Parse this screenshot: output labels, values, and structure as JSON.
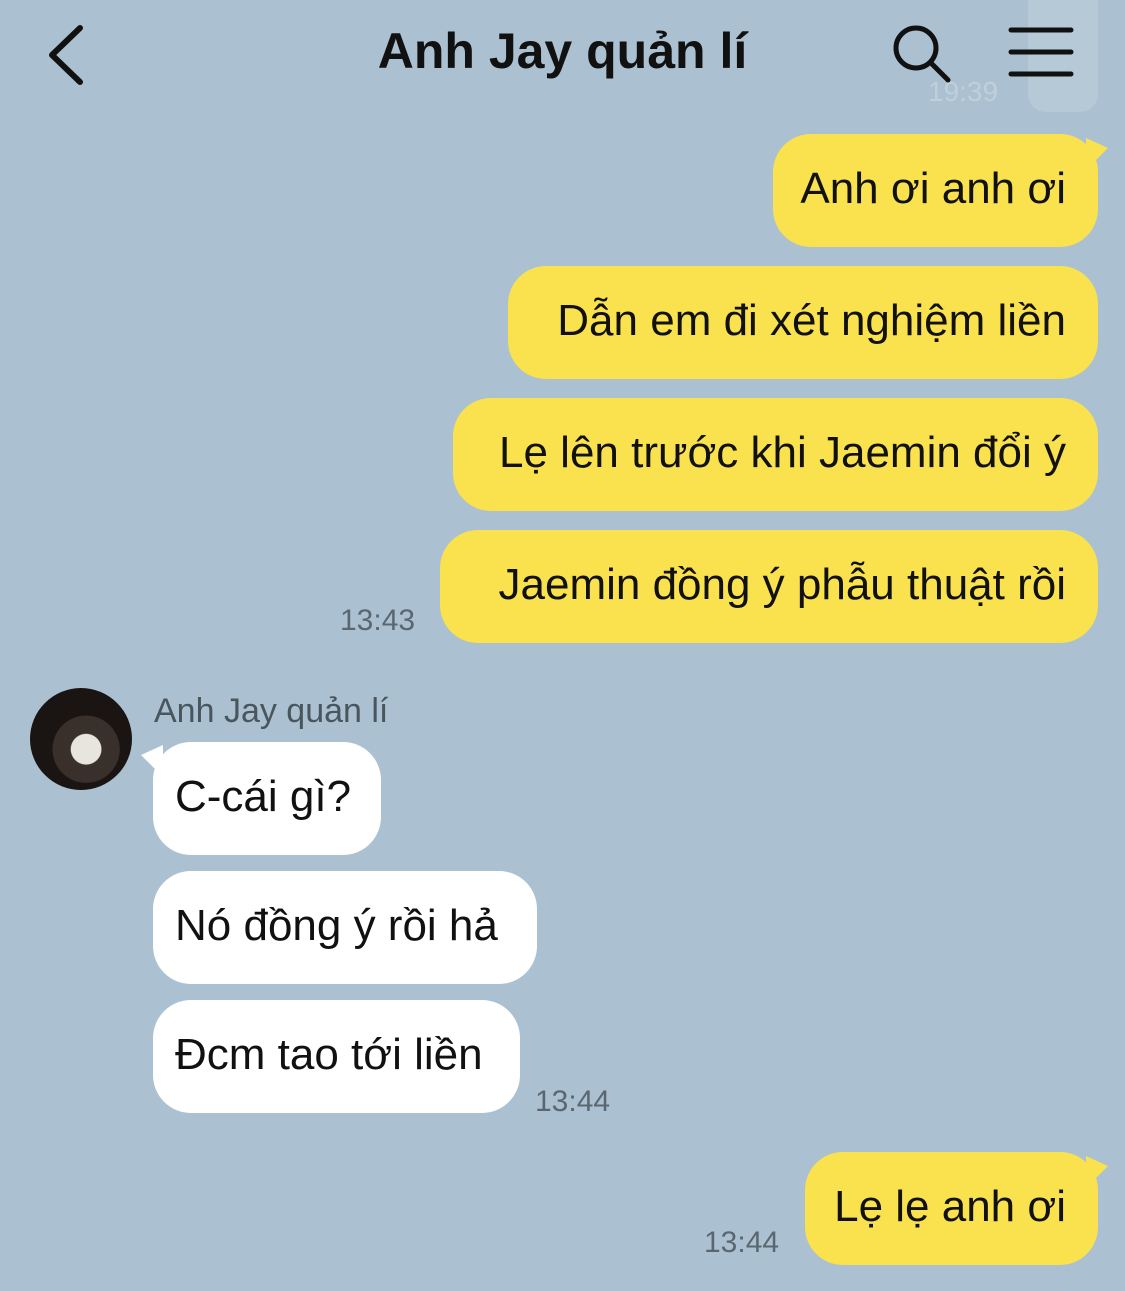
{
  "header": {
    "title": "Anh Jay quản lí",
    "ghost_time": "19:39"
  },
  "messages": {
    "m1": "Anh ơi anh ơi",
    "m2": "Dẫn em đi xét nghiệm liền",
    "m3": "Lẹ lên trước khi Jaemin đổi ý",
    "m4": "Jaemin đồng ý phẫu thuật rồi",
    "t1": "13:43",
    "sender": "Anh Jay quản lí",
    "r1": "C-cái gì?",
    "r2": "Nó đồng ý rồi hả",
    "r3": "Đcm tao tới liền",
    "t2": "13:44",
    "m5": "Lẹ lẹ anh ơi",
    "t3": "13:44"
  },
  "colors": {
    "background": "#abc1d1",
    "my_bubble": "#fae14e",
    "their_bubble": "#ffffff"
  },
  "icons": [
    "chevron-left-icon",
    "search-icon",
    "menu-icon"
  ]
}
